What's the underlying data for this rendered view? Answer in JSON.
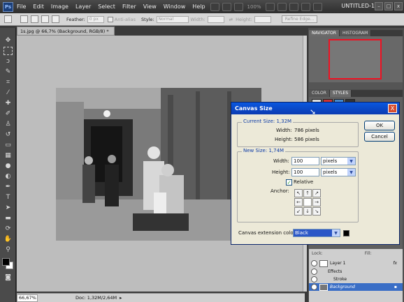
{
  "app": {
    "logo": "Ps",
    "menu": [
      "File",
      "Edit",
      "Image",
      "Layer",
      "Select",
      "Filter",
      "View",
      "Window",
      "Help"
    ],
    "zoom": "100%",
    "workspace": "UNTITLED-1",
    "window_buttons": [
      "–",
      "□",
      "x"
    ]
  },
  "options": {
    "feather_label": "Feather:",
    "feather_value": "0 px",
    "antialias_label": "Anti-alias",
    "style_label": "Style:",
    "style_value": "Normal",
    "width_label": "Width:",
    "height_label": "Height:",
    "refine_edge": "Refine Edge..."
  },
  "document": {
    "tab_title": "1s.jpg @ 66,7% (Background, RGB/8) *",
    "status_zoom": "66,67%",
    "status_doc": "Doc: 1,32M/2,64M"
  },
  "panels": {
    "top_tabs": [
      "NAVIGATOR",
      "HISTOGRAM"
    ],
    "mid_tabs": [
      "COLOR",
      "STYLES"
    ],
    "layers": {
      "lock_label": "Lock:",
      "fill_label": "Fill:",
      "rows": [
        {
          "name": "Layer 1",
          "fx": "fx"
        },
        {
          "name": "Effects"
        },
        {
          "name": "Stroke"
        },
        {
          "name": "Background"
        }
      ]
    }
  },
  "dialog": {
    "title": "Canvas Size",
    "close": "X",
    "current_size": {
      "group_title": "Current Size: 1,32M",
      "width_label": "Width:",
      "width_value": "786 pixels",
      "height_label": "Height:",
      "height_value": "586 pixels"
    },
    "new_size": {
      "group_title": "New Size: 1,74M",
      "width_label": "Width:",
      "width_value": "100",
      "width_unit": "pixels",
      "height_label": "Height:",
      "height_value": "100",
      "height_unit": "pixels",
      "relative_label": "Relative",
      "relative_checked": true,
      "anchor_label": "Anchor:"
    },
    "extension_label": "Canvas extension color:",
    "extension_value": "Black",
    "extension_swatch_color": "#000000",
    "ok_label": "OK",
    "cancel_label": "Cancel"
  }
}
